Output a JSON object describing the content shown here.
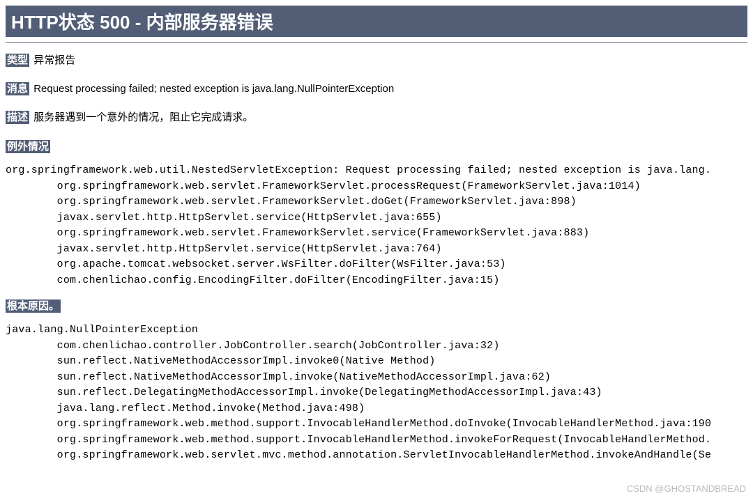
{
  "title": "HTTP状态 500 - 内部服务器错误",
  "type": {
    "label": "类型",
    "value": "异常报告"
  },
  "message": {
    "label": "消息",
    "value": "Request processing failed; nested exception is java.lang.NullPointerException"
  },
  "description": {
    "label": "描述",
    "value": "服务器遇到一个意外的情况，阻止它完成请求。"
  },
  "exception": {
    "label": "例外情况",
    "trace": "org.springframework.web.util.NestedServletException: Request processing failed; nested exception is java.lang.\n\torg.springframework.web.servlet.FrameworkServlet.processRequest(FrameworkServlet.java:1014)\n\torg.springframework.web.servlet.FrameworkServlet.doGet(FrameworkServlet.java:898)\n\tjavax.servlet.http.HttpServlet.service(HttpServlet.java:655)\n\torg.springframework.web.servlet.FrameworkServlet.service(FrameworkServlet.java:883)\n\tjavax.servlet.http.HttpServlet.service(HttpServlet.java:764)\n\torg.apache.tomcat.websocket.server.WsFilter.doFilter(WsFilter.java:53)\n\tcom.chenlichao.config.EncodingFilter.doFilter(EncodingFilter.java:15)"
  },
  "rootCause": {
    "label": "根本原因。",
    "trace": "java.lang.NullPointerException\n\tcom.chenlichao.controller.JobController.search(JobController.java:32)\n\tsun.reflect.NativeMethodAccessorImpl.invoke0(Native Method)\n\tsun.reflect.NativeMethodAccessorImpl.invoke(NativeMethodAccessorImpl.java:62)\n\tsun.reflect.DelegatingMethodAccessorImpl.invoke(DelegatingMethodAccessorImpl.java:43)\n\tjava.lang.reflect.Method.invoke(Method.java:498)\n\torg.springframework.web.method.support.InvocableHandlerMethod.doInvoke(InvocableHandlerMethod.java:190\n\torg.springframework.web.method.support.InvocableHandlerMethod.invokeForRequest(InvocableHandlerMethod.\n\torg.springframework.web.servlet.mvc.method.annotation.ServletInvocableHandlerMethod.invokeAndHandle(Se"
  },
  "watermark": "CSDN @GHOSTANDBREAD"
}
